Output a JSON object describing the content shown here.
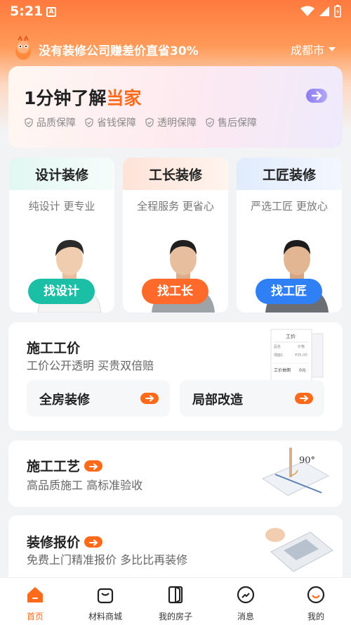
{
  "status": {
    "time": "5:21"
  },
  "header": {
    "slogan": "没有装修公司赚差价直省30%",
    "city": "成都市"
  },
  "banner": {
    "title_prefix": "1分钟了解",
    "title_highlight": "当家",
    "guarantees": [
      "品质保障",
      "省钱保障",
      "透明保障",
      "售后保障"
    ]
  },
  "services": [
    {
      "title": "设计装修",
      "subtitle": "纯设计 更专业",
      "button": "找设计",
      "color": "#1bbfa6"
    },
    {
      "title": "工长装修",
      "subtitle": "全程服务 更省心",
      "button": "找工长",
      "color": "#ff6a2a"
    },
    {
      "title": "工匠装修",
      "subtitle": "严选工匠 更放心",
      "button": "找工匠",
      "color": "#2f7ff5"
    }
  ],
  "price": {
    "title": "施工工价",
    "subtitle": "工价公开透明  买贵双倍赔",
    "whole_house": "全房装修",
    "partial": "局部改造",
    "receipt": {
      "heading": "工价",
      "col_item": "品名",
      "col_price": "价格",
      "row_item": "墙面1",
      "row_price": "¥35.00",
      "total_label": "工价抽佣",
      "total_value": "0元"
    }
  },
  "craft": {
    "title": "施工工艺",
    "subtitle": "高品质施工  高标准验收",
    "angle": "90°"
  },
  "quote": {
    "title": "装修报价",
    "subtitle": "免费上门精准报价  多比比再装修"
  },
  "nav": [
    {
      "label": "首页",
      "icon": "home-icon",
      "active": true
    },
    {
      "label": "材料商城",
      "icon": "bag-icon",
      "active": false
    },
    {
      "label": "我的房子",
      "icon": "door-icon",
      "active": false
    },
    {
      "label": "消息",
      "icon": "message-icon",
      "active": false
    },
    {
      "label": "我的",
      "icon": "profile-icon",
      "active": false
    }
  ],
  "colors": {
    "accent": "#ff6a1a"
  }
}
